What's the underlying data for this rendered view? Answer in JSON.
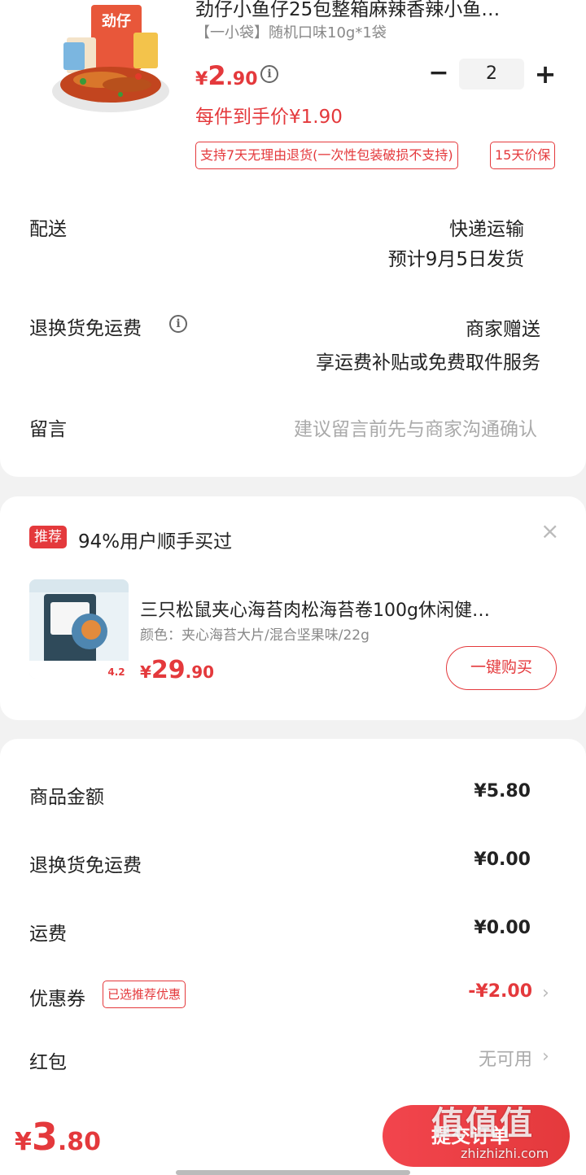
{
  "product": {
    "title": "劲仔小鱼仔25包整箱麻辣香辣小鱼…",
    "spec": "【一小袋】随机口味10g*1袋",
    "price_currency": "¥",
    "price_int": "2",
    "price_dec": ".90",
    "quantity": "2",
    "qty_minus": "−",
    "qty_plus": "+",
    "each_price": "每件到手价¥1.90",
    "tag_return": "支持7天无理由退货(一次性包装破损不支持)",
    "tag_price_protect": "15天价保",
    "image_brand": "劲仔"
  },
  "shipping": {
    "label": "配送",
    "method": "快递运输",
    "eta": "预计9月5日发货"
  },
  "return_freight": {
    "label": "退换货免运费",
    "value": "商家赠送",
    "desc": "享运费补贴或免费取件服务"
  },
  "message": {
    "label": "留言",
    "placeholder": "建议留言前先与商家沟通确认"
  },
  "recommend": {
    "badge": "推荐",
    "headline": "94%用户顺手买过",
    "close": "×",
    "item_title": "三只松鼠夹心海苔肉松海苔卷100g休闲健…",
    "item_spec": "颜色：夹心海苔大片/混合坚果味/22g",
    "price_currency": "¥",
    "price_int": "29",
    "price_dec": ".90",
    "buy_label": "一键购买",
    "image_score": "4.2"
  },
  "summary": {
    "goods_label": "商品金额",
    "goods_value": "¥5.80",
    "return_label": "退换货免运费",
    "return_value": "¥0.00",
    "freight_label": "运费",
    "freight_value": "¥0.00",
    "coupon_label": "优惠券",
    "coupon_tag": "已选推荐优惠",
    "coupon_value": "-¥2.00",
    "redpacket_label": "红包",
    "redpacket_value": "无可用",
    "chevron": "›"
  },
  "bottom": {
    "currency": "¥",
    "total_int": "3",
    "total_dec": ".80",
    "submit_label": "提交订单",
    "watermark": "值值值",
    "watermark_url": "zhizhizhi.com"
  },
  "colors": {
    "accent": "#e4393c",
    "background": "#f2f2f2"
  }
}
